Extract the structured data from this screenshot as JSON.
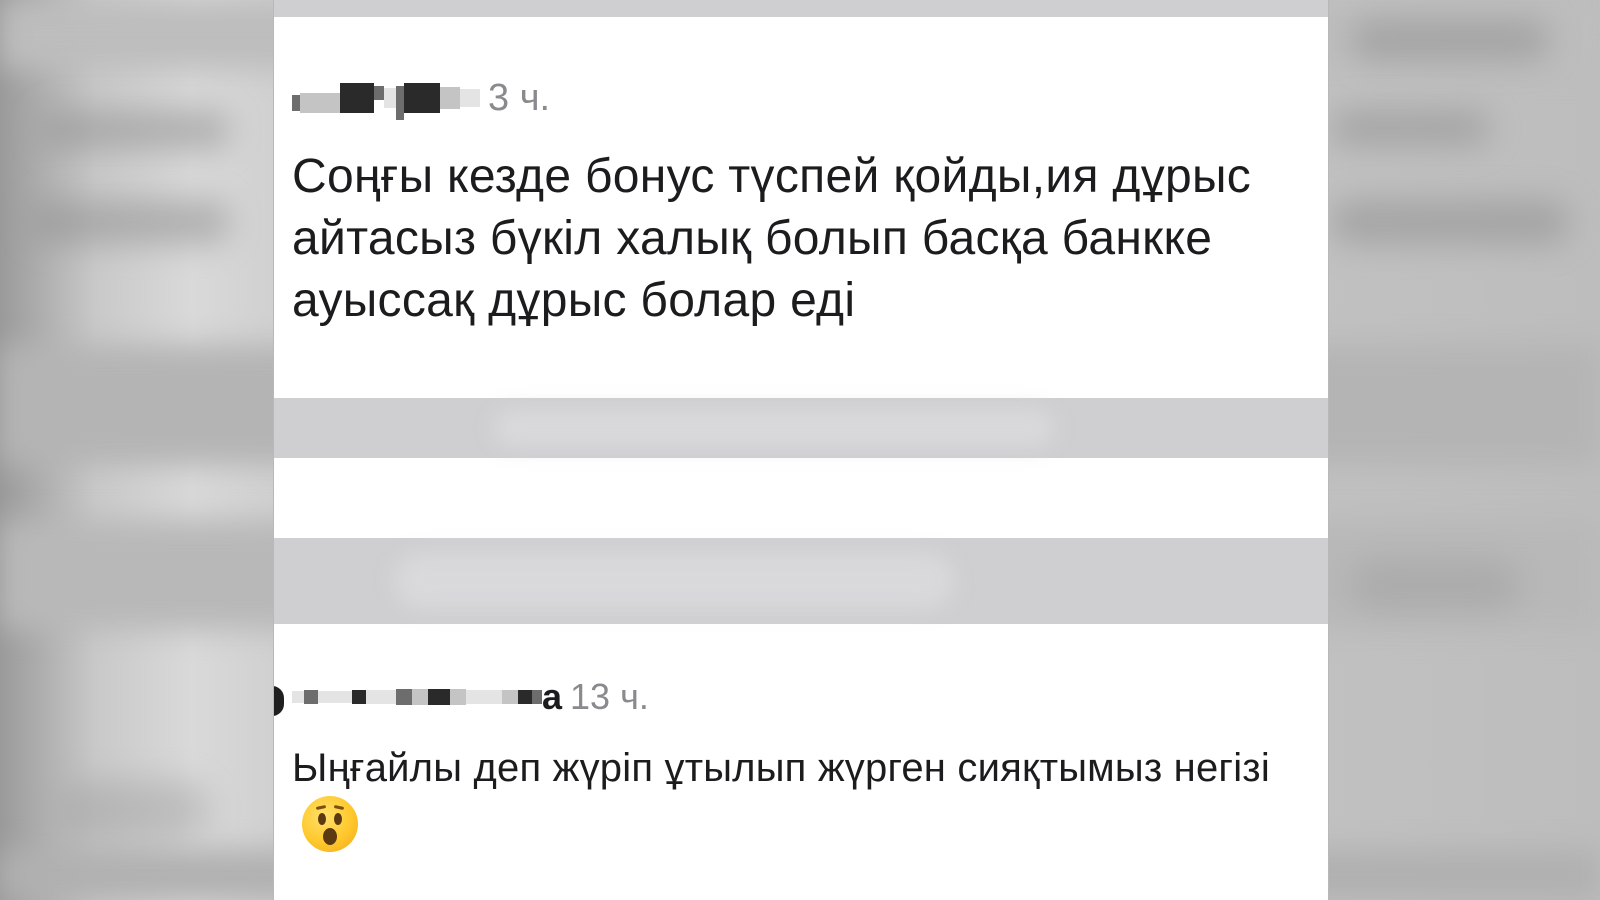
{
  "comments": [
    {
      "author_redacted": true,
      "time": "3 ч.",
      "text": "Соңғы кезде бонус түспей қойды,ия дұрыс айтасыз бүкіл халық болып басқа банкке ауыссақ дұрыс болар еді"
    },
    {
      "author_redacted": true,
      "author_tail": "а",
      "time": "13 ч.",
      "text": "Ыңғайлы деп жүріп ұтылып жүрген сияқтымыз негізі",
      "emoji": "surprised-face"
    }
  ],
  "colors": {
    "text": "#1c1c1e",
    "meta": "#8a8a8e",
    "blur_bar": "#cfcfd2",
    "background": "#ffffff"
  }
}
